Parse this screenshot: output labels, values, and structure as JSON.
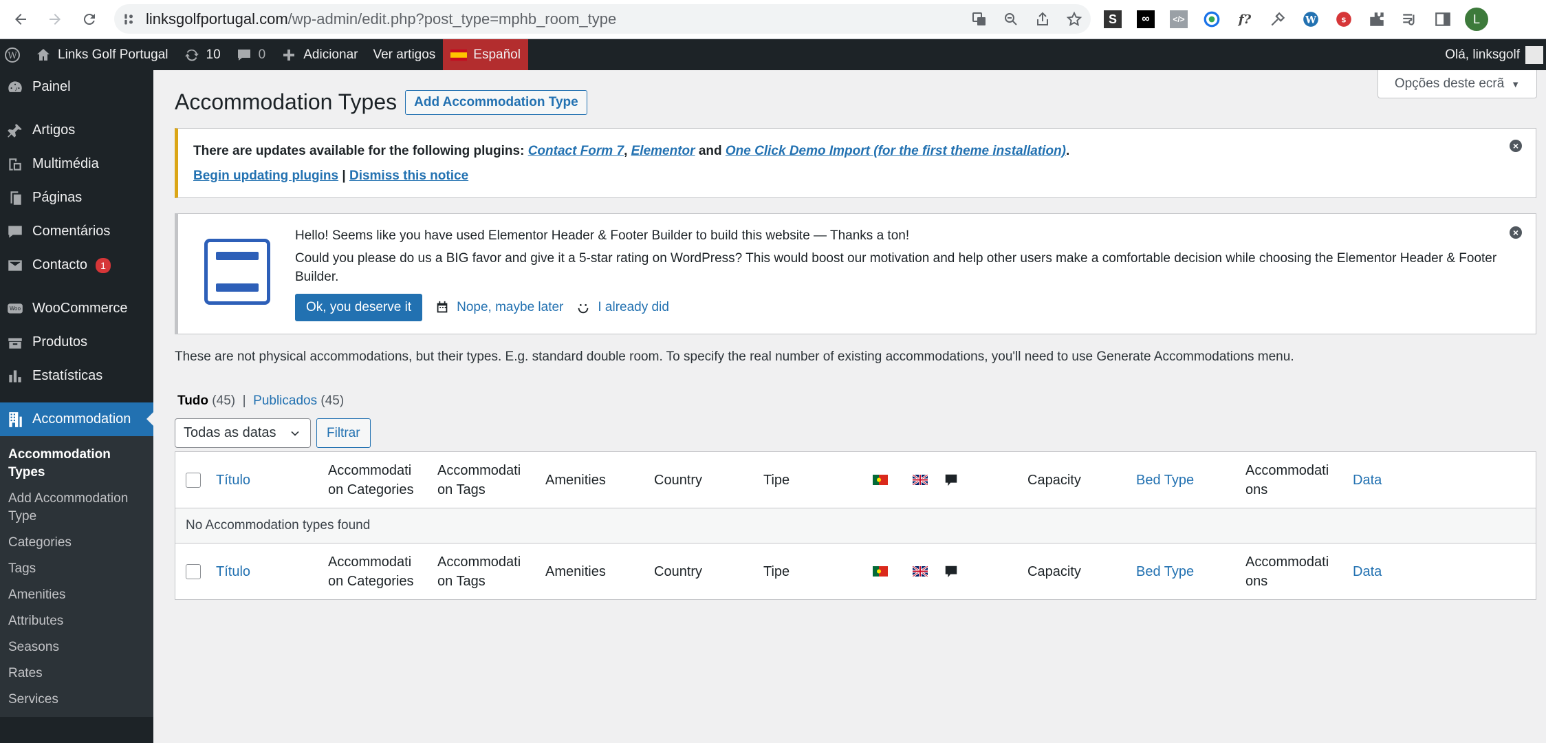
{
  "browser": {
    "url_domain": "linksgolfportugal.com",
    "url_path": "/wp-admin/edit.php?post_type=mphb_room_type",
    "profile_initial": "L"
  },
  "adminbar": {
    "site_name": "Links Golf Portugal",
    "updates_count": "10",
    "comments_count": "0",
    "add_new": "Adicionar",
    "view_posts": "Ver artigos",
    "language": "Español",
    "greeting": "Olá, linksgolf"
  },
  "sidebar": {
    "items": [
      {
        "label": "Painel",
        "icon": "dashboard-icon"
      },
      {
        "label": "Artigos",
        "icon": "pin-icon"
      },
      {
        "label": "Multimédia",
        "icon": "media-icon"
      },
      {
        "label": "Páginas",
        "icon": "pages-icon"
      },
      {
        "label": "Comentários",
        "icon": "comments-icon"
      },
      {
        "label": "Contacto",
        "icon": "mail-icon",
        "badge": "1"
      },
      {
        "label": "WooCommerce",
        "icon": "woo-icon"
      },
      {
        "label": "Produtos",
        "icon": "products-icon"
      },
      {
        "label": "Estatísticas",
        "icon": "stats-icon"
      },
      {
        "label": "Accommodation",
        "icon": "building-icon"
      }
    ],
    "submenu": [
      "Accommodation Types",
      "Add Accommodation Type",
      "Categories",
      "Tags",
      "Amenities",
      "Attributes",
      "Seasons",
      "Rates",
      "Services"
    ]
  },
  "screen_options": "Opções deste ecrã",
  "page": {
    "title": "Accommodation Types",
    "add_button": "Add Accommodation Type"
  },
  "notice_updates": {
    "intro": "There are updates available for the following plugins: ",
    "plugin1": "Contact Form 7",
    "sep1": ", ",
    "plugin2": "Elementor",
    "and": " and ",
    "plugin3": "One Click Demo Import (for the first theme installation)",
    "end": ".",
    "begin_link": "Begin updating plugins",
    "pipe": " | ",
    "dismiss_link": "Dismiss this notice"
  },
  "notice_rating": {
    "line1": "Hello! Seems like you have used Elementor Header & Footer Builder to build this website — Thanks a ton!",
    "line2": "Could you please do us a BIG favor and give it a 5-star rating on WordPress? This would boost our motivation and help other users make a comfortable decision while choosing the Elementor Header & Footer Builder.",
    "ok_button": "Ok, you deserve it",
    "later": "Nope, maybe later",
    "already": "I already did"
  },
  "description": "These are not physical accommodations, but their types. E.g. standard double room. To specify the real number of existing accommodations, you'll need to use Generate Accommodations menu.",
  "views": {
    "all_label": "Tudo",
    "all_count": "(45)",
    "sep": "|",
    "published_label": "Publicados",
    "published_count": "(45)"
  },
  "filters": {
    "dates_select": "Todas as datas",
    "filter_button": "Filtrar"
  },
  "table": {
    "columns": {
      "title": "Título",
      "categories": "Accommodati on Categories",
      "tags": "Accommodati on Tags",
      "amenities": "Amenities",
      "country": "Country",
      "tipe": "Tipe",
      "capacity": "Capacity",
      "bed_type": "Bed Type",
      "accommodations": "Accommodati ons",
      "date": "Data"
    },
    "cols_a": {
      "categories_1": "Accommodati",
      "categories_2": "on Categories",
      "tags_1": "Accommodati",
      "tags_2": "on Tags",
      "acc_1": "Accommodati",
      "acc_2": "ons"
    },
    "empty": "No Accommodation types found"
  }
}
